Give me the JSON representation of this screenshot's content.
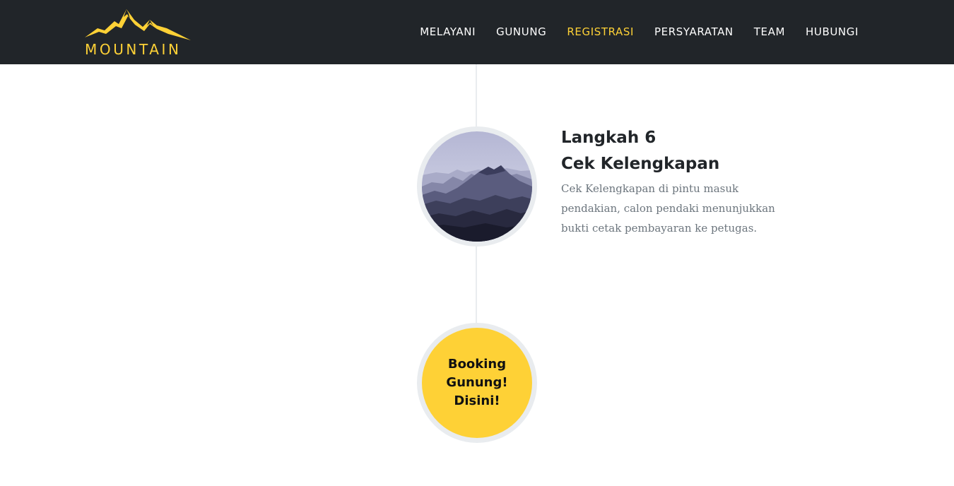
{
  "navbar": {
    "brand": "MOUNTAIN",
    "items": [
      {
        "label": "MELAYANI",
        "active": false
      },
      {
        "label": "GUNUNG",
        "active": false
      },
      {
        "label": "REGISTRASI",
        "active": true
      },
      {
        "label": "PERSYARATAN",
        "active": false
      },
      {
        "label": "TEAM",
        "active": false
      },
      {
        "label": "HUBUNGI",
        "active": false
      }
    ]
  },
  "timeline": {
    "step": {
      "subheading": "Langkah 6",
      "title": "Cek Kelengkapan",
      "description": "Cek Kelengkapan di pintu masuk pendakian, calon pendaki menunjukkan bukti cetak pembayaran ke petugas.",
      "image_icon": "mountain-image"
    },
    "cta": {
      "line1": "Booking",
      "line2": "Gunung!",
      "line3": "Disini!"
    }
  },
  "colors": {
    "navbar_bg": "#212529",
    "accent": "#fed136",
    "timeline_line": "#e9ecef",
    "heading": "#212529",
    "muted_text": "#6c757d"
  }
}
